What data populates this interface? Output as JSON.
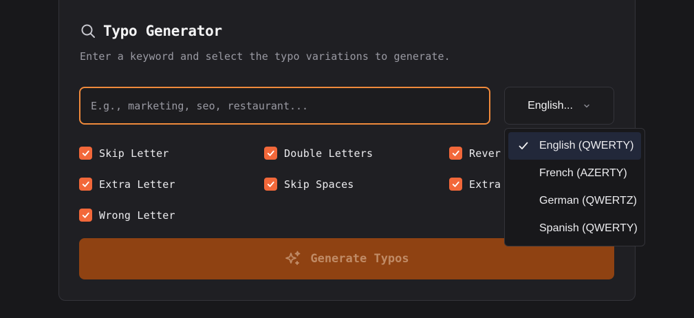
{
  "header": {
    "title": "Typo Generator",
    "subtitle": "Enter a keyword and select the typo variations to generate."
  },
  "keyword_input": {
    "placeholder": "E.g., marketing, seo, restaurant...",
    "value": ""
  },
  "language_select": {
    "selected_label": "English...",
    "options": [
      {
        "label": "English (QWERTY)",
        "selected": true
      },
      {
        "label": "French (AZERTY)",
        "selected": false
      },
      {
        "label": "German (QWERTZ)",
        "selected": false
      },
      {
        "label": "Spanish (QWERTY)",
        "selected": false
      }
    ]
  },
  "typo_options": [
    {
      "label": "Skip Letter",
      "checked": true
    },
    {
      "label": "Double Letters",
      "checked": true
    },
    {
      "label": "Rever",
      "checked": true
    },
    {
      "label": "Extra Letter",
      "checked": true
    },
    {
      "label": "Skip Spaces",
      "checked": true
    },
    {
      "label": "Extra",
      "checked": true
    },
    {
      "label": "Wrong Letter",
      "checked": true
    }
  ],
  "generate_button": {
    "label": "Generate Typos"
  },
  "colors": {
    "accent": "#f2683a",
    "input_focus_border": "#f08a3c",
    "button_bg": "#8f4212",
    "card_bg": "#1f1f23",
    "page_bg": "#18181b"
  }
}
